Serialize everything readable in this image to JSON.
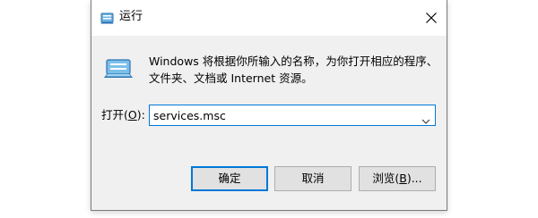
{
  "window": {
    "title": "运行",
    "close_label": "×"
  },
  "description": {
    "line1": "Windows 将根据你所输入的名称，为你打开相应的程序、",
    "line2": "文件夹、文档或 Internet 资源。"
  },
  "open_field": {
    "label_prefix": "打开(",
    "label_accel": "O",
    "label_suffix": "):",
    "value": "services.msc"
  },
  "buttons": {
    "ok": "确定",
    "cancel": "取消",
    "browse_prefix": "浏览(",
    "browse_accel": "B",
    "browse_suffix": ")..."
  },
  "colors": {
    "accent": "#0078d7",
    "button_face": "#e1e1e1",
    "dialog_bg": "#f0f0f0"
  },
  "icons": {
    "title": "run-icon",
    "big": "run-icon",
    "close": "close-icon",
    "dropdown": "chevron-down-icon"
  }
}
